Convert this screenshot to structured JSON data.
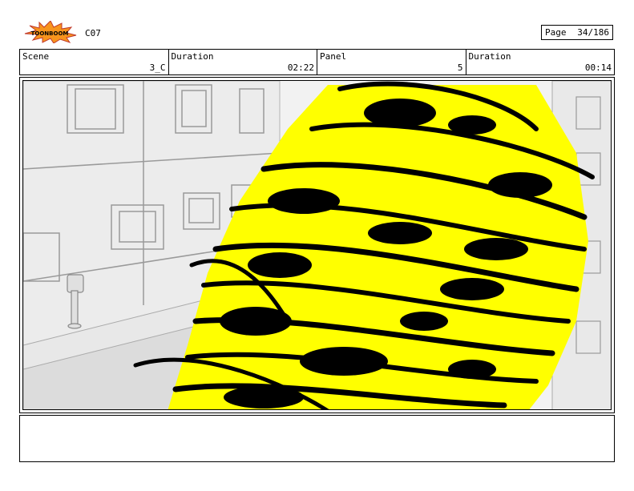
{
  "header": {
    "logo_text": "TOONBOOM",
    "code": "C07",
    "page_label": "Page",
    "page_value": "34/186"
  },
  "info": {
    "scene_label": "Scene",
    "scene_value": "3_C",
    "duration1_label": "Duration",
    "duration1_value": "02:22",
    "panel_label": "Panel",
    "panel_value": "5",
    "duration2_label": "Duration",
    "duration2_value": "00:14"
  },
  "colors": {
    "tornado_yellow": "#ffff00",
    "ink": "#000000",
    "building_grey": "#e6e6e6"
  },
  "notes": {
    "text": ""
  }
}
